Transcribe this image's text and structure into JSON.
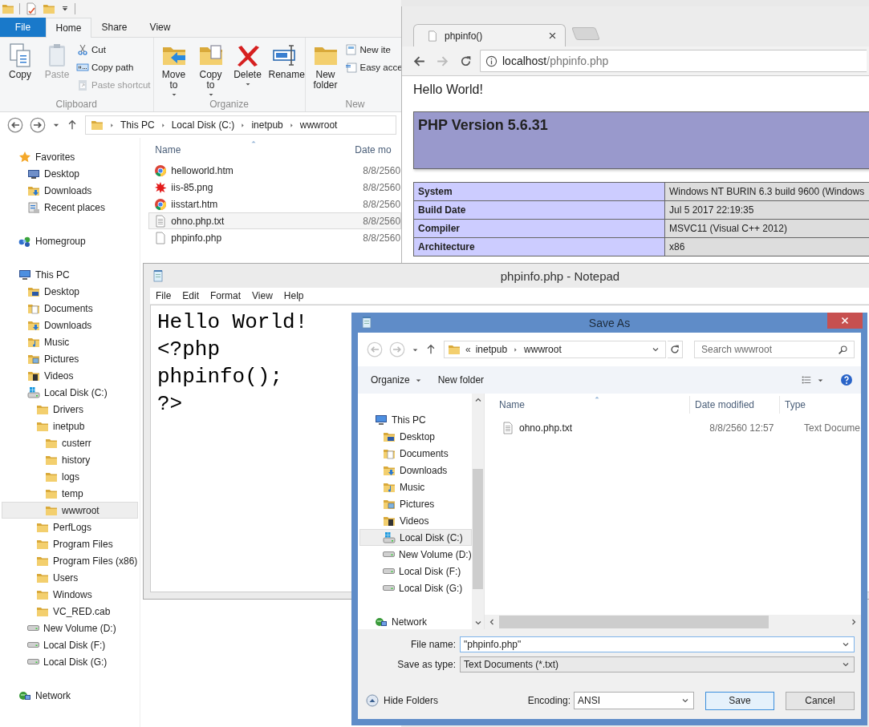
{
  "explorer": {
    "ribbon_tabs": [
      {
        "label": "File",
        "kind": "menu",
        "selected": false
      },
      {
        "label": "Home",
        "kind": "tab",
        "selected": true
      },
      {
        "label": "Share",
        "kind": "tab",
        "selected": false
      },
      {
        "label": "View",
        "kind": "tab",
        "selected": false
      }
    ],
    "ribbon_groups": [
      {
        "label": "Clipboard",
        "commands": [
          {
            "label": "Copy",
            "kind": "large",
            "disabled": false
          },
          {
            "label": "Paste",
            "kind": "large",
            "disabled": true
          },
          {
            "label": "Cut",
            "kind": "small",
            "disabled": false
          },
          {
            "label": "Copy path",
            "kind": "small",
            "disabled": false
          },
          {
            "label": "Paste shortcut",
            "kind": "small",
            "disabled": true
          }
        ]
      },
      {
        "label": "Organize",
        "commands": [
          {
            "label": "Move to",
            "kind": "large-menu",
            "disabled": false
          },
          {
            "label": "Copy to",
            "kind": "large-menu",
            "disabled": false
          },
          {
            "label": "Delete",
            "kind": "large-menu",
            "disabled": false
          },
          {
            "label": "Rename",
            "kind": "large",
            "disabled": false
          }
        ]
      },
      {
        "label": "New",
        "commands": [
          {
            "label": "New folder",
            "kind": "large",
            "disabled": false
          },
          {
            "label": "New ite",
            "kind": "small",
            "disabled": false
          },
          {
            "label": "Easy acce",
            "kind": "small",
            "disabled": false
          }
        ]
      }
    ],
    "breadcrumb": [
      "This PC",
      "Local Disk (C:)",
      "inetpub",
      "wwwroot"
    ],
    "nav": [
      {
        "label": "Favorites",
        "kind": "favorites",
        "selected": false,
        "children": [
          {
            "label": "Desktop",
            "kind": "desktop",
            "selected": false
          },
          {
            "label": "Downloads",
            "kind": "downloads",
            "selected": false
          },
          {
            "label": "Recent places",
            "kind": "recent",
            "selected": false
          }
        ]
      },
      {
        "label": "Homegroup",
        "kind": "homegroup",
        "selected": false
      },
      {
        "label": "This PC",
        "kind": "pc",
        "selected": false,
        "children": [
          {
            "label": "Desktop",
            "kind": "desktop-folder",
            "selected": false
          },
          {
            "label": "Documents",
            "kind": "documents",
            "selected": false
          },
          {
            "label": "Downloads",
            "kind": "downloads",
            "selected": false
          },
          {
            "label": "Music",
            "kind": "music",
            "selected": false
          },
          {
            "label": "Pictures",
            "kind": "pictures",
            "selected": false
          },
          {
            "label": "Videos",
            "kind": "videos",
            "selected": false
          },
          {
            "label": "Local Disk (C:)",
            "kind": "system-drive",
            "selected": false,
            "children": [
              {
                "label": "Drivers",
                "kind": "folder",
                "selected": false
              },
              {
                "label": "inetpub",
                "kind": "folder",
                "selected": false,
                "children": [
                  {
                    "label": "custerr",
                    "kind": "folder",
                    "selected": false
                  },
                  {
                    "label": "history",
                    "kind": "folder",
                    "selected": false
                  },
                  {
                    "label": "logs",
                    "kind": "folder",
                    "selected": false
                  },
                  {
                    "label": "temp",
                    "kind": "folder",
                    "selected": false
                  },
                  {
                    "label": "wwwroot",
                    "kind": "folder",
                    "selected": true
                  }
                ]
              },
              {
                "label": "PerfLogs",
                "kind": "folder",
                "selected": false
              },
              {
                "label": "Program Files",
                "kind": "folder",
                "selected": false
              },
              {
                "label": "Program Files (x86)",
                "kind": "folder",
                "selected": false
              },
              {
                "label": "Users",
                "kind": "folder",
                "selected": false
              },
              {
                "label": "Windows",
                "kind": "folder",
                "selected": false
              },
              {
                "label": "VC_RED.cab",
                "kind": "folder",
                "selected": false
              }
            ]
          },
          {
            "label": "New Volume (D:)",
            "kind": "drive",
            "selected": false
          },
          {
            "label": "Local Disk (F:)",
            "kind": "drive",
            "selected": false
          },
          {
            "label": "Local Disk (G:)",
            "kind": "drive",
            "selected": false
          }
        ]
      },
      {
        "label": "Network",
        "kind": "network",
        "selected": false
      }
    ],
    "columns": [
      "Name",
      "Date mo"
    ],
    "files": [
      {
        "name": "helloworld.htm",
        "kind": "web",
        "date": "8/8/2560",
        "selected": false
      },
      {
        "name": "iis-85.png",
        "kind": "image",
        "date": "8/8/2560",
        "selected": false
      },
      {
        "name": "iisstart.htm",
        "kind": "web",
        "date": "8/8/2560",
        "selected": false
      },
      {
        "name": "ohno.php.txt",
        "kind": "text",
        "date": "8/8/2560",
        "selected": true
      },
      {
        "name": "phpinfo.php",
        "kind": "file",
        "date": "8/8/2560",
        "selected": false
      }
    ]
  },
  "browser": {
    "tab": "phpinfo()",
    "url_host": "localhost",
    "url_path": "/phpinfo.php",
    "heading": "Hello World!",
    "php_version": "PHP Version 5.6.31",
    "info_rows": [
      {
        "label": "System",
        "value": "Windows NT BURIN 6.3 build 9600 (Windows"
      },
      {
        "label": "Build Date",
        "value": "Jul 5 2017 22:19:35"
      },
      {
        "label": "Compiler",
        "value": "MSVC11 (Visual C++ 2012)"
      },
      {
        "label": "Architecture",
        "value": "x86"
      }
    ]
  },
  "notepad": {
    "title": "phpinfo.php - Notepad",
    "menu": [
      "File",
      "Edit",
      "Format",
      "View",
      "Help"
    ],
    "lines": [
      "Hello World!",
      "<?php",
      "phpinfo();",
      "?>"
    ]
  },
  "save_dialog": {
    "title": "Save As",
    "path_overflow": "«",
    "path": [
      "inetpub",
      "wwwroot"
    ],
    "search_placeholder": "Search wwwroot",
    "toolbar": [
      {
        "label": "Organize",
        "menu": true
      },
      {
        "label": "New folder",
        "menu": false
      }
    ],
    "nav": [
      {
        "label": "This PC",
        "kind": "pc",
        "selected": false,
        "children": [
          {
            "label": "Desktop",
            "kind": "desktop-folder",
            "selected": false
          },
          {
            "label": "Documents",
            "kind": "documents",
            "selected": false
          },
          {
            "label": "Downloads",
            "kind": "downloads",
            "selected": false
          },
          {
            "label": "Music",
            "kind": "music",
            "selected": false
          },
          {
            "label": "Pictures",
            "kind": "pictures",
            "selected": false
          },
          {
            "label": "Videos",
            "kind": "videos",
            "selected": false
          },
          {
            "label": "Local Disk (C:)",
            "kind": "system-drive",
            "selected": true
          },
          {
            "label": "New Volume (D:)",
            "kind": "drive",
            "selected": false
          },
          {
            "label": "Local Disk (F:)",
            "kind": "drive",
            "selected": false
          },
          {
            "label": "Local Disk (G:)",
            "kind": "drive",
            "selected": false
          }
        ]
      },
      {
        "label": "Network",
        "kind": "network",
        "selected": false
      }
    ],
    "columns": [
      "Name",
      "Date modified",
      "Type"
    ],
    "files": [
      {
        "name": "ohno.php.txt",
        "kind": "text",
        "modified": "8/8/2560 12:57",
        "type": "Text Docume",
        "selected": false
      }
    ],
    "fields": [
      {
        "label": "File name:",
        "value": "\"phpinfo.php\"",
        "kind": "edit"
      },
      {
        "label": "Save as type:",
        "value": "Text Documents (*.txt)",
        "kind": "dropdown"
      }
    ],
    "hide_folders": "Hide Folders",
    "encoding_label": "Encoding:",
    "encoding": "ANSI",
    "buttons": [
      {
        "label": "Save",
        "default": true
      },
      {
        "label": "Cancel",
        "default": false
      }
    ]
  }
}
